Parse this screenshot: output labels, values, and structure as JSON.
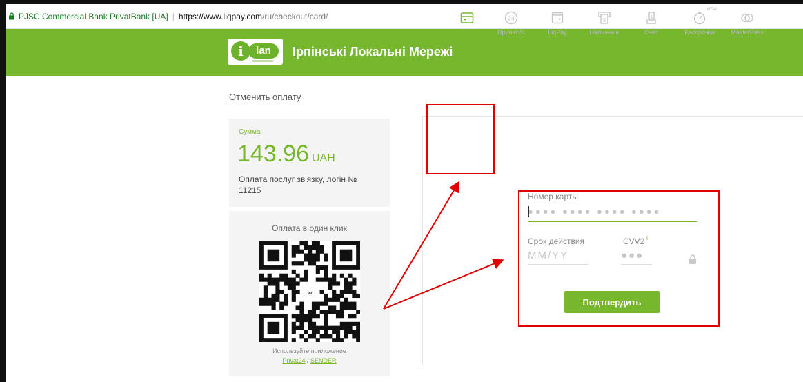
{
  "browser": {
    "secure_label": "PJSC Commercial Bank PrivatBank [UA]",
    "url_host": "https://www.liqpay.com",
    "url_path": "/ru/checkout/card/"
  },
  "header": {
    "logo_letter": "i",
    "logo_word": "lan",
    "brand_name": "Ірпінські Локальні Мережі",
    "color": "#77b72e"
  },
  "cancel_label": "Отменить оплату",
  "amount": {
    "label": "Сумма",
    "value": "143.96",
    "currency": "UAH",
    "description": "Оплата послуг зв'язку, логін № 11215"
  },
  "oneclick": {
    "title": "Оплата в один клик",
    "hint": "Используйте приложение",
    "app1": "Privat24",
    "separator": " / ",
    "app2": "SENDER"
  },
  "methods": [
    {
      "label": "Карта",
      "icon": "card-icon",
      "active": true
    },
    {
      "label": "Приват24",
      "icon": "privat24-icon"
    },
    {
      "label": "LiqPay",
      "icon": "wallet-icon"
    },
    {
      "label": "Наличные",
      "icon": "cash-icon"
    },
    {
      "label": "Счёт",
      "icon": "invoice-icon"
    },
    {
      "label": "Рассрочка",
      "icon": "stopwatch-icon",
      "badge": "NEW"
    },
    {
      "label": "MasterPass",
      "icon": "masterpass-icon"
    }
  ],
  "form": {
    "card_label": "Номер карты",
    "card_placeholder": "●●●● ●●●● ●●●● ●●●●",
    "expiry_label": "Срок действия",
    "expiry_placeholder": "MM/YY",
    "cvv_label": "CVV2",
    "cvv_info": "i",
    "cvv_placeholder": "●●●",
    "submit_label": "Подтвердить"
  }
}
